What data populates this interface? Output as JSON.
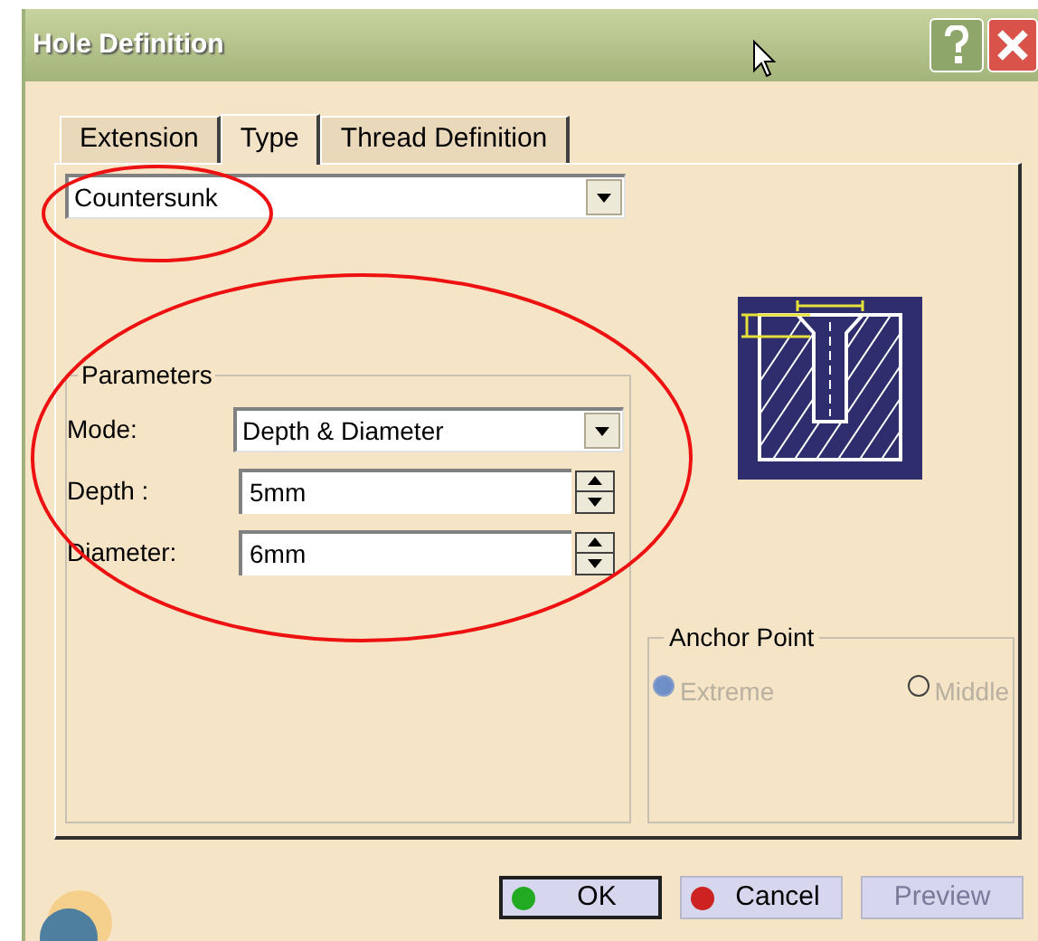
{
  "window": {
    "title": "Hole Definition"
  },
  "tabs": [
    {
      "label": "Extension",
      "selected": false
    },
    {
      "label": "Type",
      "selected": true
    },
    {
      "label": "Thread Definition",
      "selected": false
    }
  ],
  "type_combo": {
    "value": "Countersunk"
  },
  "parameters": {
    "title": "Parameters",
    "rows": [
      {
        "kind": "combo",
        "label": "Mode:",
        "value": "Depth & Diameter"
      },
      {
        "kind": "spin",
        "label": "Depth :",
        "value": "5mm"
      },
      {
        "kind": "spin",
        "label": "Diameter:",
        "value": "6mm"
      }
    ]
  },
  "anchor_point": {
    "title": "Anchor Point",
    "options": [
      {
        "label": "Extreme",
        "selected": true,
        "disabled": true
      },
      {
        "label": "Middle",
        "selected": false,
        "disabled": true
      }
    ]
  },
  "buttons": [
    {
      "label": "OK",
      "color": "#22aa22",
      "default": true,
      "disabled": false
    },
    {
      "label": "Cancel",
      "color": "#cc2222",
      "default": false,
      "disabled": false
    },
    {
      "label": "Preview",
      "disabled": true,
      "default": false
    }
  ]
}
